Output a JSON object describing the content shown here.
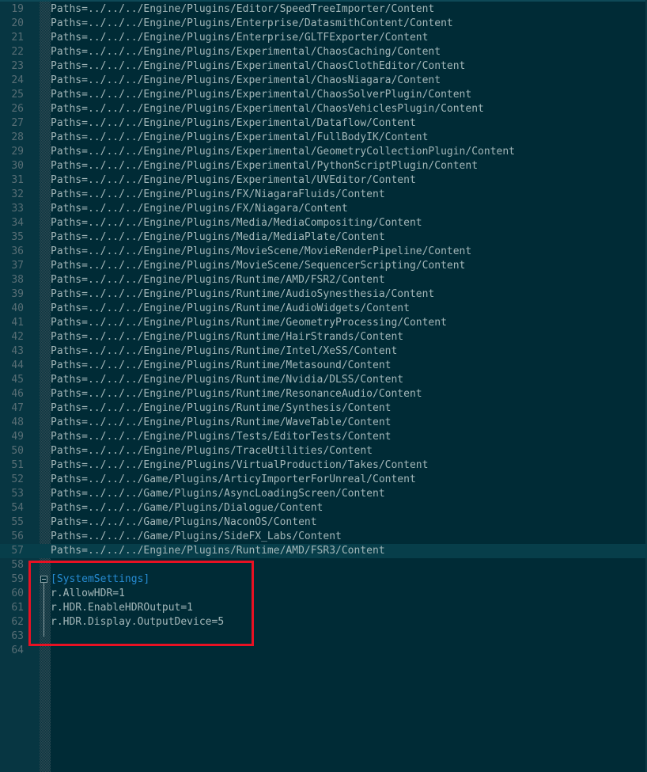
{
  "editor": {
    "lines": [
      {
        "num": "19",
        "text": "Paths=../../../Engine/Plugins/Editor/SpeedTreeImporter/Content"
      },
      {
        "num": "20",
        "text": "Paths=../../../Engine/Plugins/Enterprise/DatasmithContent/Content"
      },
      {
        "num": "21",
        "text": "Paths=../../../Engine/Plugins/Enterprise/GLTFExporter/Content"
      },
      {
        "num": "22",
        "text": "Paths=../../../Engine/Plugins/Experimental/ChaosCaching/Content"
      },
      {
        "num": "23",
        "text": "Paths=../../../Engine/Plugins/Experimental/ChaosClothEditor/Content"
      },
      {
        "num": "24",
        "text": "Paths=../../../Engine/Plugins/Experimental/ChaosNiagara/Content"
      },
      {
        "num": "25",
        "text": "Paths=../../../Engine/Plugins/Experimental/ChaosSolverPlugin/Content"
      },
      {
        "num": "26",
        "text": "Paths=../../../Engine/Plugins/Experimental/ChaosVehiclesPlugin/Content"
      },
      {
        "num": "27",
        "text": "Paths=../../../Engine/Plugins/Experimental/Dataflow/Content"
      },
      {
        "num": "28",
        "text": "Paths=../../../Engine/Plugins/Experimental/FullBodyIK/Content"
      },
      {
        "num": "29",
        "text": "Paths=../../../Engine/Plugins/Experimental/GeometryCollectionPlugin/Content"
      },
      {
        "num": "30",
        "text": "Paths=../../../Engine/Plugins/Experimental/PythonScriptPlugin/Content"
      },
      {
        "num": "31",
        "text": "Paths=../../../Engine/Plugins/Experimental/UVEditor/Content"
      },
      {
        "num": "32",
        "text": "Paths=../../../Engine/Plugins/FX/NiagaraFluids/Content"
      },
      {
        "num": "33",
        "text": "Paths=../../../Engine/Plugins/FX/Niagara/Content"
      },
      {
        "num": "34",
        "text": "Paths=../../../Engine/Plugins/Media/MediaCompositing/Content"
      },
      {
        "num": "35",
        "text": "Paths=../../../Engine/Plugins/Media/MediaPlate/Content"
      },
      {
        "num": "36",
        "text": "Paths=../../../Engine/Plugins/MovieScene/MovieRenderPipeline/Content"
      },
      {
        "num": "37",
        "text": "Paths=../../../Engine/Plugins/MovieScene/SequencerScripting/Content"
      },
      {
        "num": "38",
        "text": "Paths=../../../Engine/Plugins/Runtime/AMD/FSR2/Content"
      },
      {
        "num": "39",
        "text": "Paths=../../../Engine/Plugins/Runtime/AudioSynesthesia/Content"
      },
      {
        "num": "40",
        "text": "Paths=../../../Engine/Plugins/Runtime/AudioWidgets/Content"
      },
      {
        "num": "41",
        "text": "Paths=../../../Engine/Plugins/Runtime/GeometryProcessing/Content"
      },
      {
        "num": "42",
        "text": "Paths=../../../Engine/Plugins/Runtime/HairStrands/Content"
      },
      {
        "num": "43",
        "text": "Paths=../../../Engine/Plugins/Runtime/Intel/XeSS/Content"
      },
      {
        "num": "44",
        "text": "Paths=../../../Engine/Plugins/Runtime/Metasound/Content"
      },
      {
        "num": "45",
        "text": "Paths=../../../Engine/Plugins/Runtime/Nvidia/DLSS/Content"
      },
      {
        "num": "46",
        "text": "Paths=../../../Engine/Plugins/Runtime/ResonanceAudio/Content"
      },
      {
        "num": "47",
        "text": "Paths=../../../Engine/Plugins/Runtime/Synthesis/Content"
      },
      {
        "num": "48",
        "text": "Paths=../../../Engine/Plugins/Runtime/WaveTable/Content"
      },
      {
        "num": "49",
        "text": "Paths=../../../Engine/Plugins/Tests/EditorTests/Content"
      },
      {
        "num": "50",
        "text": "Paths=../../../Engine/Plugins/TraceUtilities/Content"
      },
      {
        "num": "51",
        "text": "Paths=../../../Engine/Plugins/VirtualProduction/Takes/Content"
      },
      {
        "num": "52",
        "text": "Paths=../../../Game/Plugins/ArticyImporterForUnreal/Content"
      },
      {
        "num": "53",
        "text": "Paths=../../../Game/Plugins/AsyncLoadingScreen/Content"
      },
      {
        "num": "54",
        "text": "Paths=../../../Game/Plugins/Dialogue/Content"
      },
      {
        "num": "55",
        "text": "Paths=../../../Game/Plugins/NaconOS/Content"
      },
      {
        "num": "56",
        "text": "Paths=../../../Game/Plugins/SideFX_Labs/Content"
      },
      {
        "num": "57",
        "text": "Paths=../../../Engine/Plugins/Runtime/AMD/FSR3/Content"
      },
      {
        "num": "58",
        "text": ""
      },
      {
        "num": "59",
        "text": "[SystemSettings]"
      },
      {
        "num": "60",
        "text": "r.AllowHDR=1"
      },
      {
        "num": "61",
        "text": "r.HDR.EnableHDROutput=1"
      },
      {
        "num": "62",
        "text": "r.HDR.Display.OutputDevice=5"
      },
      {
        "num": "63",
        "text": ""
      },
      {
        "num": "64",
        "text": ""
      }
    ],
    "current_line": "57",
    "section_line": "59"
  },
  "colors": {
    "background": "#002b36",
    "gutter": "#073642",
    "line_number": "#586e75",
    "text": "#a3b7b9",
    "section_header": "#268bd2",
    "highlight_box": "#e81123"
  }
}
